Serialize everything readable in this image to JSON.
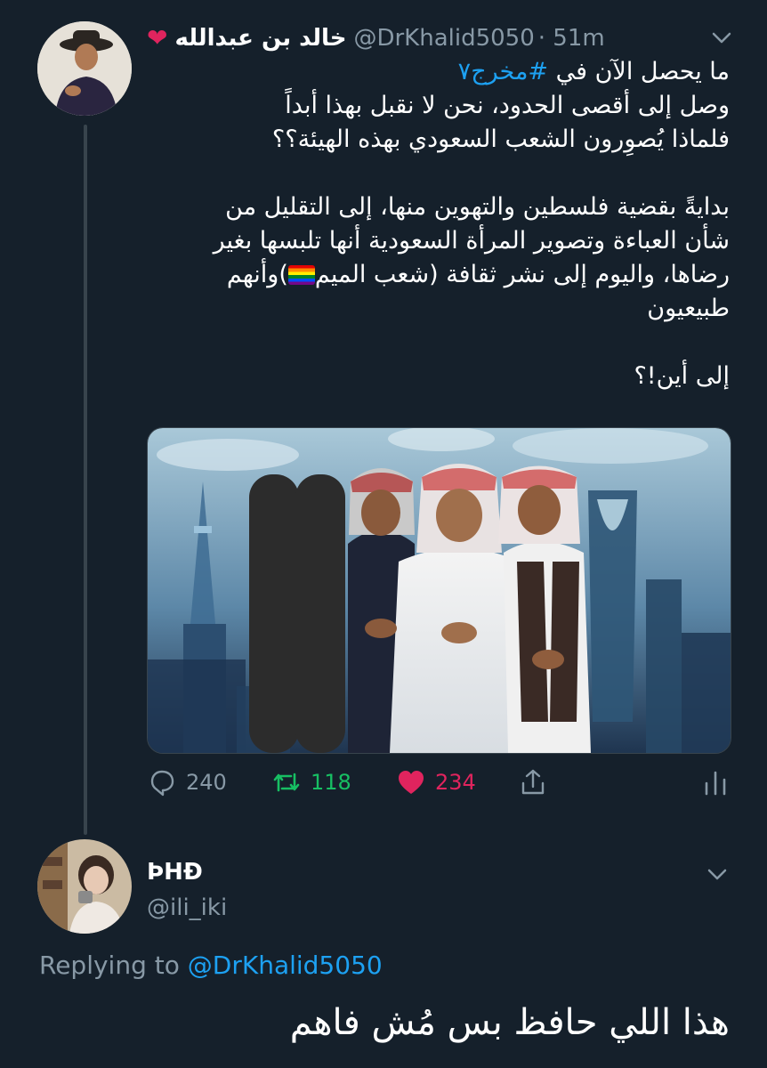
{
  "tweet": {
    "author_name": "خالد بن عبدالله",
    "author_handle": "@DrKhalid5050",
    "time": "· 51m",
    "line1_before": "ما يحصل الآن في ",
    "hashtag": "#مخرج٧",
    "line2": "وصل إلى أقصى الحدود، نحن لا نقبل بهذا أبداً",
    "line3": "فلماذا يُصوِرون الشعب السعودي بهذه الهيئة؟؟",
    "line4": "بدايةً بقضية فلسطين والتهوين منها، إلى التقليل من",
    "line5": "شأن العباءة وتصوير المرأة السعودية أنها تلبسها بغير",
    "line6_before": "رضاها، واليوم إلى نشر ثقافة (شعب الميم",
    "line6_after": ")وأنهم",
    "line7": "طبيعيون",
    "line8": "إلى أين!؟",
    "counts": {
      "replies": "240",
      "retweets": "118",
      "likes": "234"
    }
  },
  "colors": {
    "background": "#15202b",
    "accent": "#1da1f2",
    "like": "#e0245e",
    "retweet": "#17bf63",
    "muted": "#8899a6"
  },
  "reply": {
    "name": "ÞHÐ",
    "handle": "@ili_iki",
    "replying_prefix": "Replying to ",
    "replying_to": "@DrKhalid5050",
    "text": "هذا اللي حافظ بس مُش فاهم"
  }
}
